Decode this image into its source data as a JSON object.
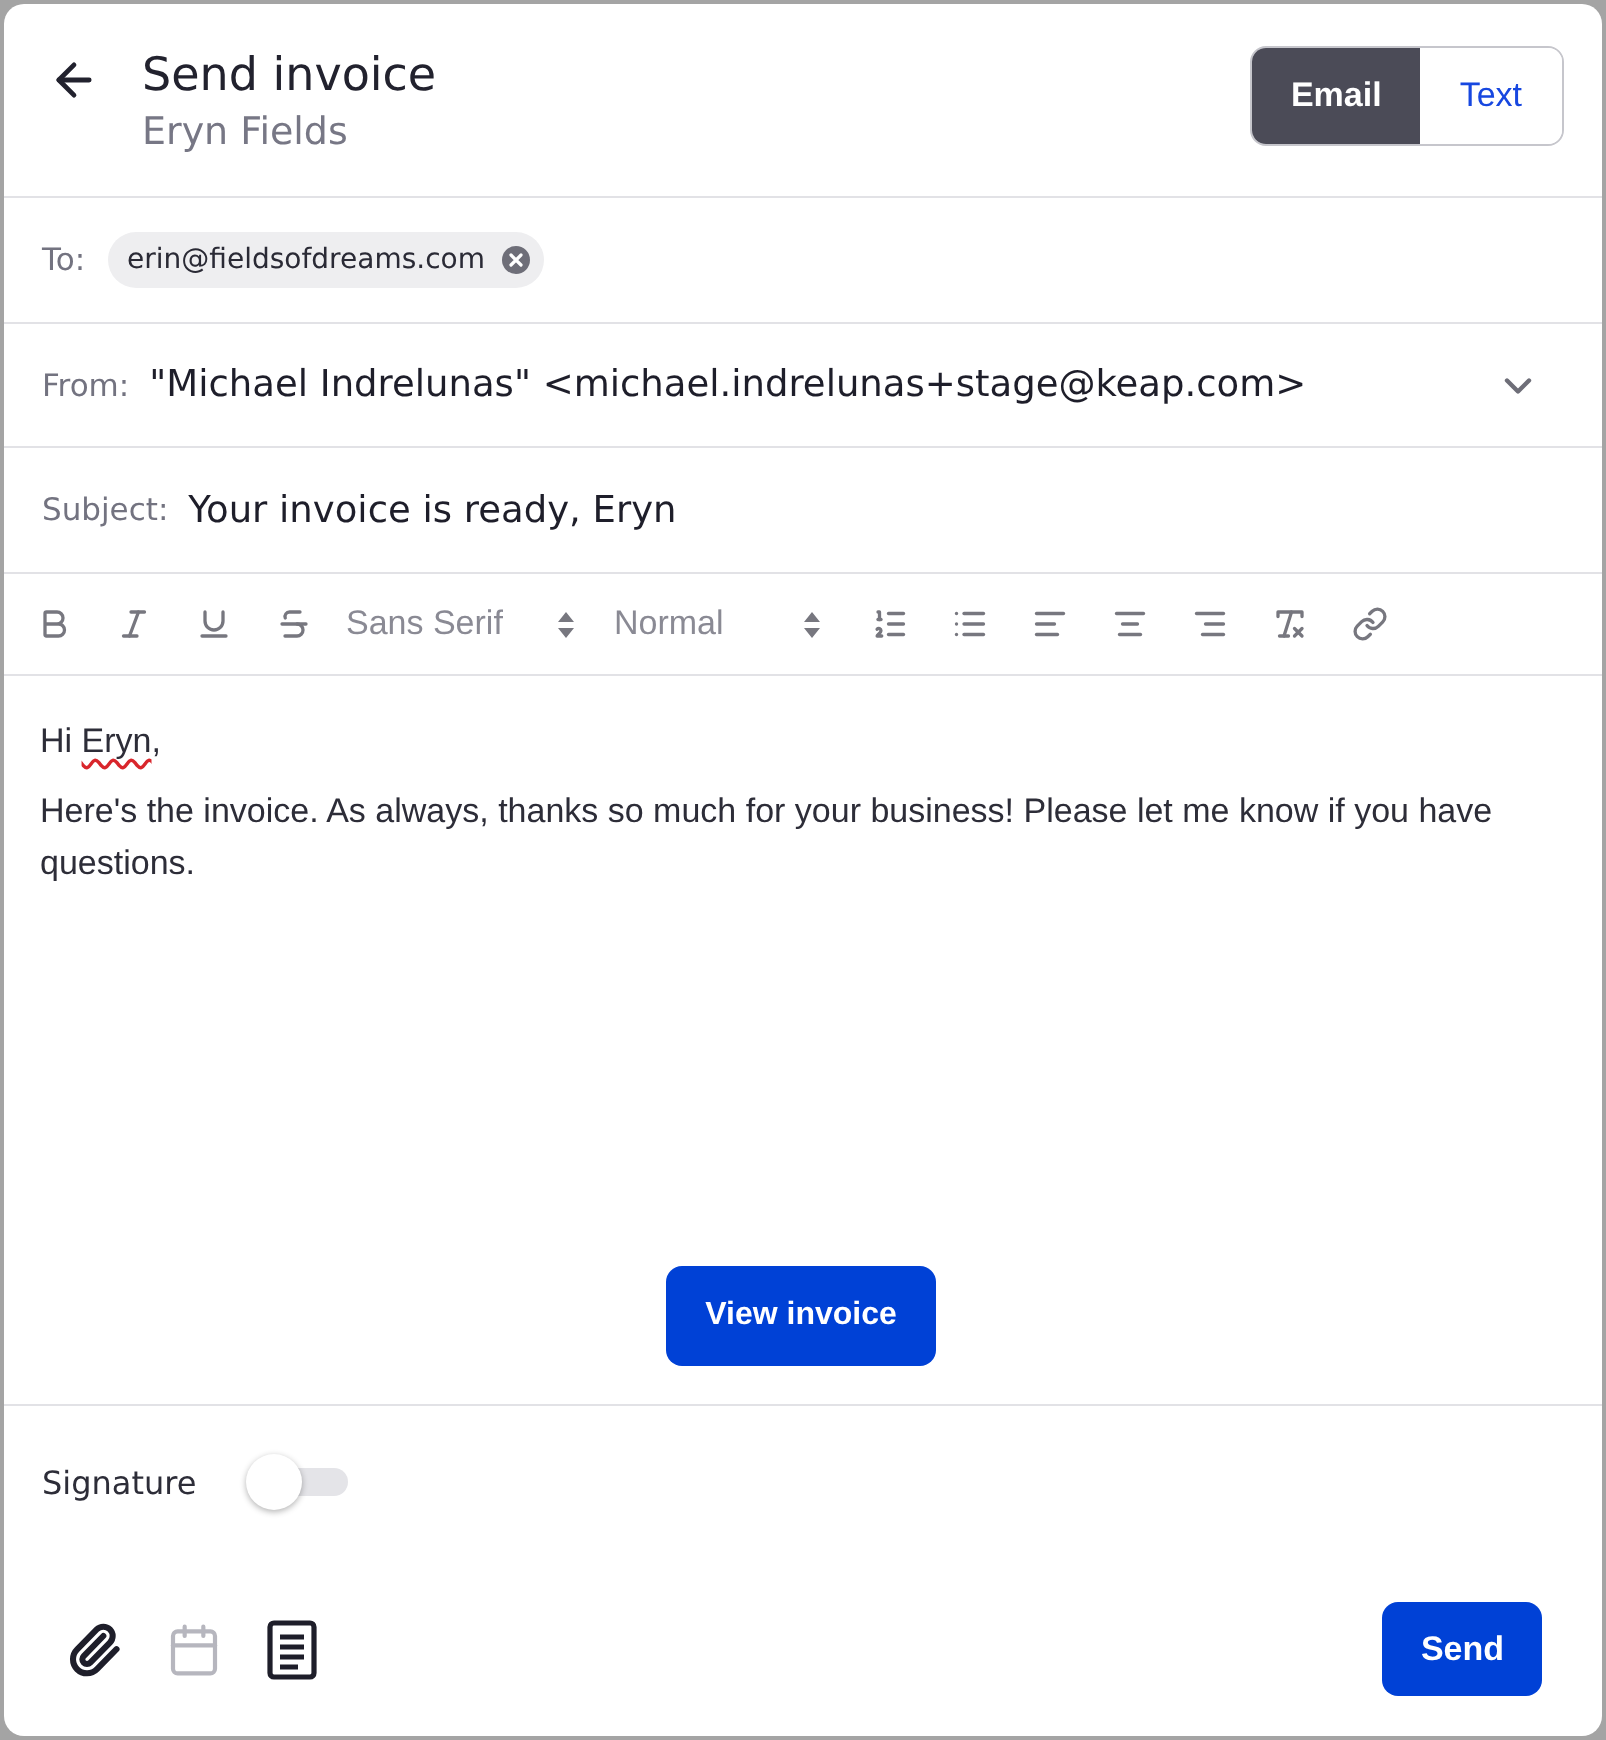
{
  "header": {
    "title": "Send invoice",
    "subtitle": "Eryn Fields",
    "modes": [
      {
        "label": "Email",
        "selected": true
      },
      {
        "label": "Text",
        "selected": false
      }
    ]
  },
  "to": {
    "label": "To:",
    "recipients": [
      {
        "address": "erin@fieldsofdreams.com"
      }
    ]
  },
  "from": {
    "label": "From:",
    "value": "\"Michael Indrelunas\" <michael.indrelunas+stage@keap.com>"
  },
  "subject": {
    "label": "Subject:",
    "value": "Your invoice is ready, Eryn"
  },
  "toolbar": {
    "font": "Sans Serif",
    "size": "Normal"
  },
  "message": {
    "greeting": [
      {
        "text": "Hi "
      },
      {
        "text": "Eryn",
        "misspelled": true
      },
      {
        "text": ","
      }
    ],
    "body": "Here's the invoice. As always, thanks so much for your business! Please let me know if you have questions."
  },
  "view_invoice_button": "View invoice",
  "signature": {
    "label": "Signature",
    "on": false
  },
  "tools": [
    {
      "kind": "attach",
      "disabled": false
    },
    {
      "kind": "schedule",
      "disabled": true
    },
    {
      "kind": "template",
      "disabled": false
    }
  ],
  "send_button": "Send"
}
